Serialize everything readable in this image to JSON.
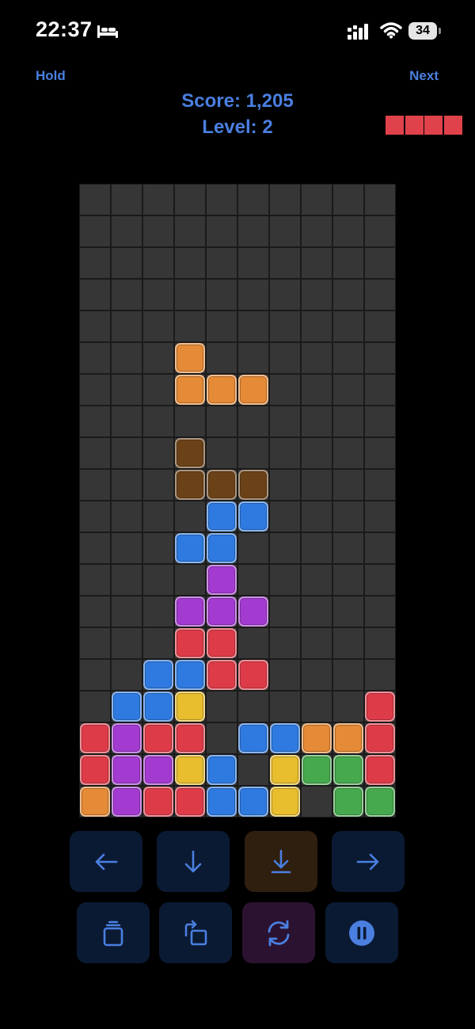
{
  "status_bar": {
    "time": "22:37",
    "battery": "34"
  },
  "header": {
    "hold_label": "Hold",
    "next_label": "Next",
    "score": "Score: 1,205",
    "level": "Level: 2"
  },
  "next_piece": {
    "color": "#e0424c",
    "cells": 4
  },
  "board": {
    "columns": 10,
    "rows": 20,
    "colors": {
      "O": "#e58a36",
      "D": "#6b4218",
      "B": "#2f7ae0",
      "P": "#a33bd0",
      "R": "#de3b48",
      "Y": "#e8bd2e",
      "G": "#47a94e"
    },
    "grid": [
      "..........",
      "..........",
      "..........",
      "..........",
      "..........",
      "...O......",
      "...OOO....",
      "..........",
      "...D......",
      "...DDD....",
      "....BB....",
      "...BB.....",
      "....P.....",
      "...PPP....",
      "...RR.....",
      "..BBRR....",
      ".BBY.....R",
      "RPRR.BBOOR",
      "RPPYB.YGGR",
      "OPRRBBY.GG"
    ]
  },
  "controls": {
    "accent": "#4a7fe0",
    "buttons": [
      {
        "name": "move-left-button",
        "icon": "arrow-left-icon"
      },
      {
        "name": "soft-drop-button",
        "icon": "arrow-down-icon"
      },
      {
        "name": "hard-drop-button",
        "icon": "hard-drop-icon"
      },
      {
        "name": "move-right-button",
        "icon": "arrow-right-icon"
      },
      {
        "name": "hold-button",
        "icon": "stack-icon"
      },
      {
        "name": "rotate-button",
        "icon": "rotate-icon"
      },
      {
        "name": "swap-button",
        "icon": "cycle-icon"
      },
      {
        "name": "pause-button",
        "icon": "pause-icon"
      }
    ]
  }
}
